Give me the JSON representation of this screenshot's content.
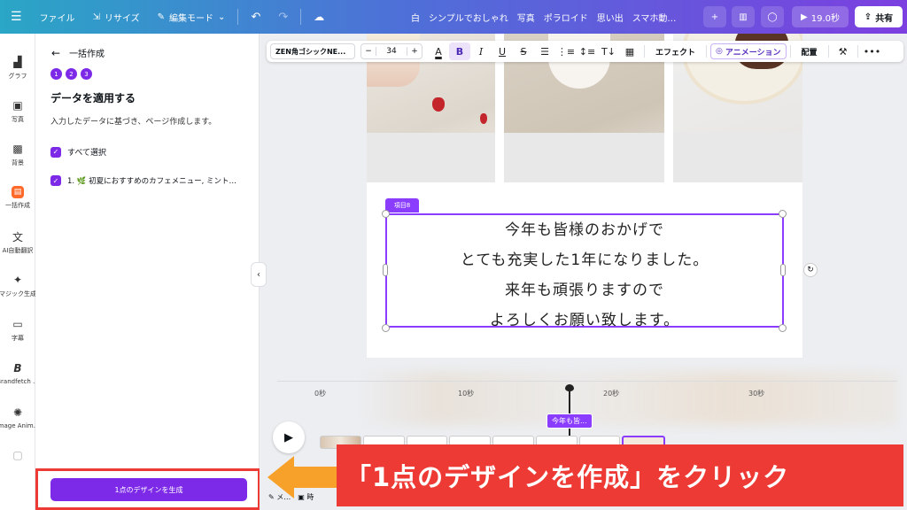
{
  "topbar": {
    "file": "ファイル",
    "resize": "リサイズ",
    "edit_mode": "編集モード",
    "title": "白　シンプルでおしゃれ　写真　ポラロイド　思い出　スマホ動…",
    "play_duration": "19.0秒",
    "share": "共有"
  },
  "rail": {
    "items": [
      {
        "label": "グラフ"
      },
      {
        "label": "写真"
      },
      {
        "label": "背景"
      },
      {
        "label": "一括作成"
      },
      {
        "label": "AI自動翻訳"
      },
      {
        "label": "マジック生成"
      },
      {
        "label": "字幕"
      },
      {
        "label": "Brandfetch ..."
      },
      {
        "label": "Image Anim..."
      }
    ]
  },
  "panel": {
    "back_label": "一括作成",
    "steps": [
      "1",
      "2",
      "3"
    ],
    "heading": "データを適用する",
    "description": "入力したデータに基づき、ページ作成します。",
    "select_all": "すべて選択",
    "row1": "1. 🌿 初夏におすすめのカフェメニュー, ミント…",
    "generate_button": "1点のデザインを生成"
  },
  "text_toolbar": {
    "font": "ZEN角ゴシックNE...",
    "minus": "−",
    "size": "34",
    "plus": "+",
    "effects": "エフェクト",
    "animation": "アニメーション",
    "position": "配置"
  },
  "canvas": {
    "tag": "項目8",
    "lines": [
      "今年も皆様のおかげで",
      "とても充実した1年になりました。",
      "来年も頑張りますので",
      "よろしくお願い致します。"
    ]
  },
  "timeline": {
    "ticks": [
      "0秒",
      "10秒",
      "20秒",
      "30秒"
    ],
    "clip_label": "今年も皆...",
    "bottom_a": "メ…",
    "bottom_b": "時"
  },
  "annotation": {
    "text": "「1点のデザインを作成」をクリック"
  },
  "colors": {
    "accent": "#7d2ae8",
    "banner": "#ee3a35",
    "arrow": "#f7a12b"
  }
}
